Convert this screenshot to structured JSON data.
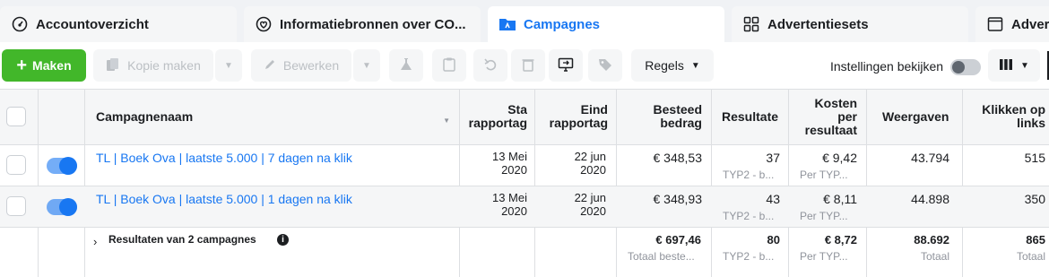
{
  "tabs": [
    {
      "label": "Accountoverzicht",
      "icon": "gauge-icon"
    },
    {
      "label": "Informatiebronnen over CO...",
      "icon": "heart-shield-icon"
    },
    {
      "label": "Campagnes",
      "icon": "folder-icon"
    },
    {
      "label": "Advertentiesets",
      "icon": "grid-icon"
    },
    {
      "label": "Advert",
      "icon": "window-icon"
    }
  ],
  "toolbar": {
    "create_label": "Maken",
    "copy_label": "Kopie maken",
    "edit_label": "Bewerken",
    "rules_label": "Regels",
    "settings_label": "Instellingen bekijken"
  },
  "table": {
    "headers": {
      "name": "Campagnenaam",
      "start": "Sta\nrapportag",
      "end": "Eind\nrapportag",
      "spent": "Besteed\nbedrag",
      "results": "Resultate",
      "cost": "Kosten\nper\nresultaat",
      "views": "Weergaven",
      "clicks": "Klikken op\nlinks"
    },
    "rows": [
      {
        "name": "TL | Boek Ova | laatste 5.000 | 7 dagen na klik",
        "start": "13 Mei\n2020",
        "end": "22 jun\n2020",
        "spent": "€ 348,53",
        "results": "37",
        "results_sub": "TYP2 - b...",
        "cost": "€ 9,42",
        "cost_sub": "Per TYP...",
        "views": "43.794",
        "clicks": "515"
      },
      {
        "name": "TL | Boek Ova | laatste 5.000 | 1 dagen na klik",
        "start": "13 Mei\n2020",
        "end": "22 jun\n2020",
        "spent": "€ 348,93",
        "results": "43",
        "results_sub": "TYP2 - b...",
        "cost": "€ 8,11",
        "cost_sub": "Per TYP...",
        "views": "44.898",
        "clicks": "350"
      }
    ],
    "summary": {
      "label": "Resultaten van 2 campagnes",
      "spent": "€ 697,46",
      "spent_sub": "Totaal beste...",
      "results": "80",
      "results_sub": "TYP2 - b...",
      "cost": "€ 8,72",
      "cost_sub": "Per TYP...",
      "views": "88.692",
      "views_sub": "Totaal",
      "clicks": "865",
      "clicks_sub": "Totaal"
    }
  },
  "colors": {
    "accent": "#1877f2",
    "create": "#42b72a"
  }
}
